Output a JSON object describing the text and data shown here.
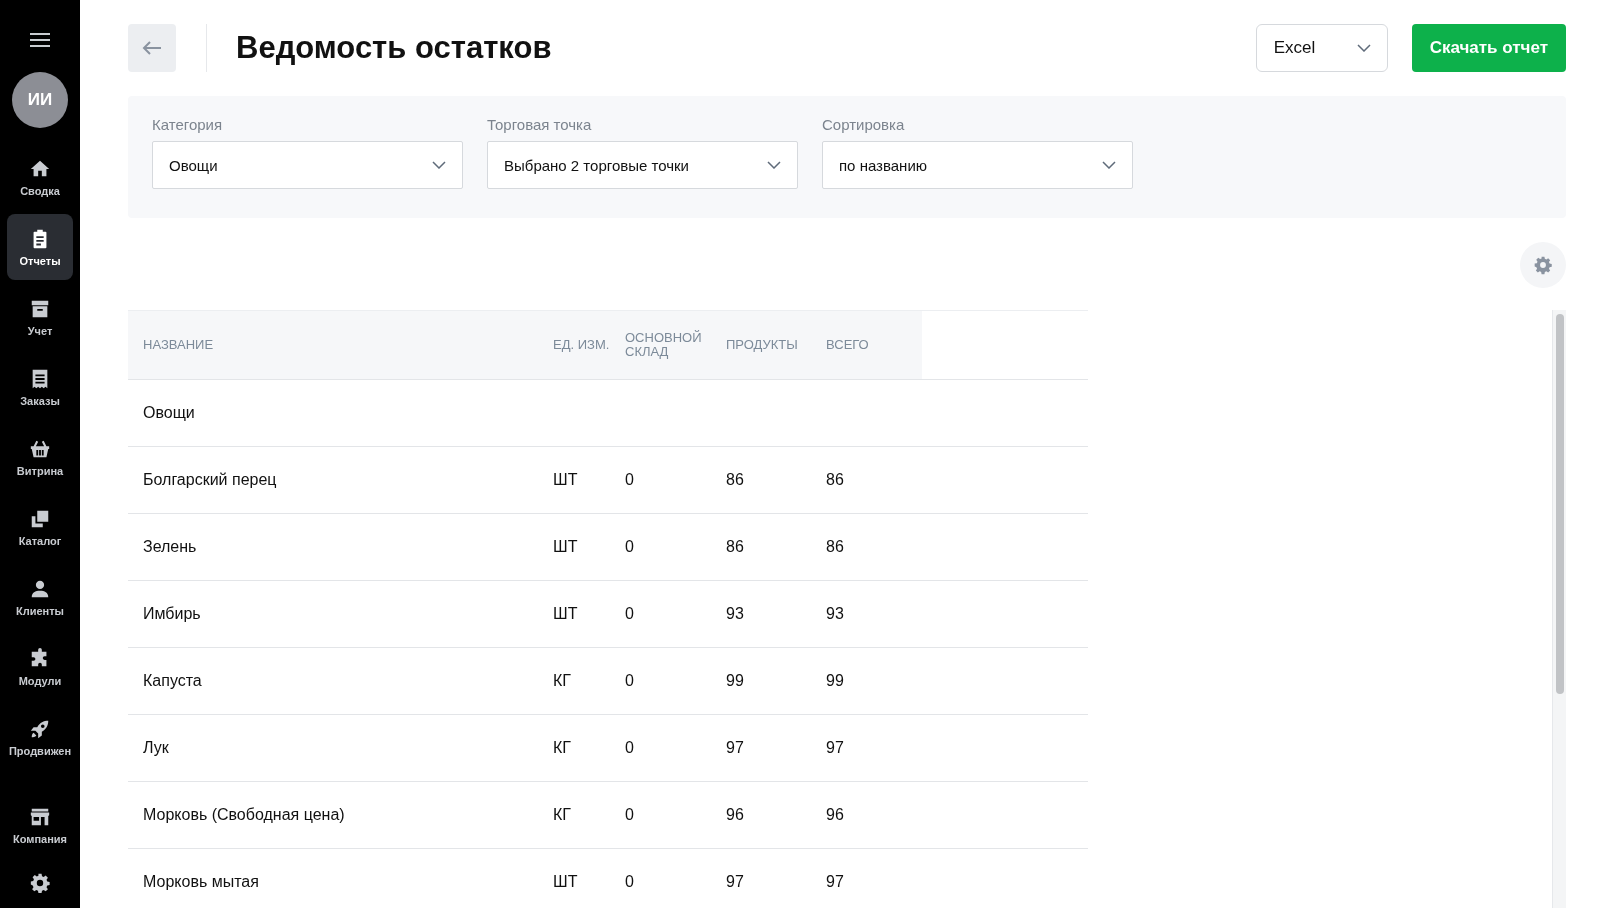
{
  "sidebar": {
    "avatar": "ИИ",
    "items": [
      {
        "label": "Сводка",
        "selected": false
      },
      {
        "label": "Отчеты",
        "selected": true
      },
      {
        "label": "Учет",
        "selected": false
      },
      {
        "label": "Заказы",
        "selected": false
      },
      {
        "label": "Витрина",
        "selected": false
      },
      {
        "label": "Каталог",
        "selected": false
      },
      {
        "label": "Клиенты",
        "selected": false
      },
      {
        "label": "Модули",
        "selected": false
      },
      {
        "label": "Продвижен",
        "selected": false
      }
    ],
    "bottom_items": [
      {
        "label": "Компания",
        "selected": false
      }
    ]
  },
  "header": {
    "title": "Ведомость остатков",
    "format_select": {
      "value": "Excel"
    },
    "download_button": "Скачать отчет"
  },
  "filters": [
    {
      "label": "Категория",
      "value": "Овощи"
    },
    {
      "label": "Торговая точка",
      "value": "Выбрано 2 торговые точки"
    },
    {
      "label": "Сортировка",
      "value": "по названию"
    }
  ],
  "table": {
    "columns": [
      "НАЗВАНИЕ",
      "ЕД. ИЗМ.",
      "ОСНОВНОЙ СКЛАД",
      "ПРОДУКТЫ",
      "ВСЕГО"
    ],
    "rows": [
      {
        "kind": "group",
        "cells": [
          "Овощи"
        ]
      },
      {
        "kind": "item",
        "cells": [
          "Болгарский перец",
          "ШТ",
          "0",
          "86",
          "86"
        ]
      },
      {
        "kind": "item",
        "cells": [
          "Зелень",
          "ШТ",
          "0",
          "86",
          "86"
        ]
      },
      {
        "kind": "item",
        "cells": [
          "Имбирь",
          "ШТ",
          "0",
          "93",
          "93"
        ]
      },
      {
        "kind": "item",
        "cells": [
          "Капуста",
          "КГ",
          "0",
          "99",
          "99"
        ]
      },
      {
        "kind": "item",
        "cells": [
          "Лук",
          "КГ",
          "0",
          "97",
          "97"
        ]
      },
      {
        "kind": "item",
        "cells": [
          "Морковь (Свободная цена)",
          "КГ",
          "0",
          "96",
          "96"
        ]
      },
      {
        "kind": "item",
        "cells": [
          "Морковь мытая",
          "ШТ",
          "0",
          "97",
          "97"
        ]
      }
    ]
  }
}
